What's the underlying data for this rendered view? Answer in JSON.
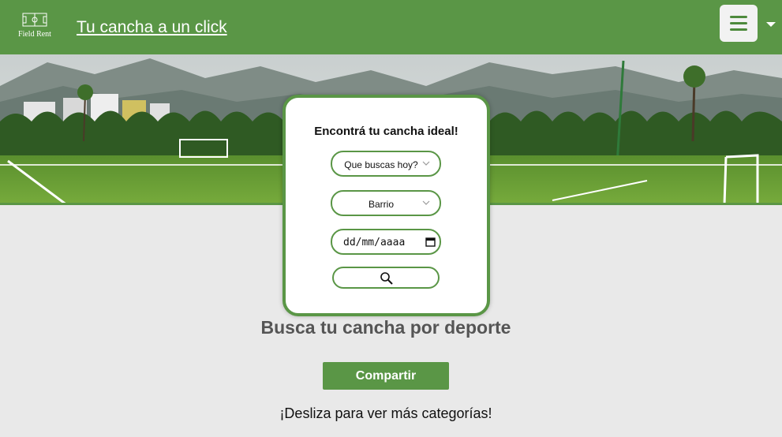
{
  "header": {
    "logo_text": "Field Rent",
    "tagline": "Tu cancha a un click",
    "menu_icon": "hamburger-menu-icon",
    "dropdown_icon": "caret-down-icon"
  },
  "hero": {
    "image": "soccer-field-mountains"
  },
  "search_card": {
    "title": "Encontrá tu cancha ideal!",
    "sport_select": "Que buscas hoy?",
    "neighborhood_select": "Barrio",
    "date_placeholder": "dd/mm/aaaa",
    "search_icon": "magnifier-icon"
  },
  "main": {
    "section_title": "Busca tu cancha por deporte",
    "share_label": "Compartir",
    "swipe_hint": "¡Desliza para ver más categorías!"
  },
  "colors": {
    "brand_green": "#5a9646",
    "background": "#e9e9e9"
  }
}
